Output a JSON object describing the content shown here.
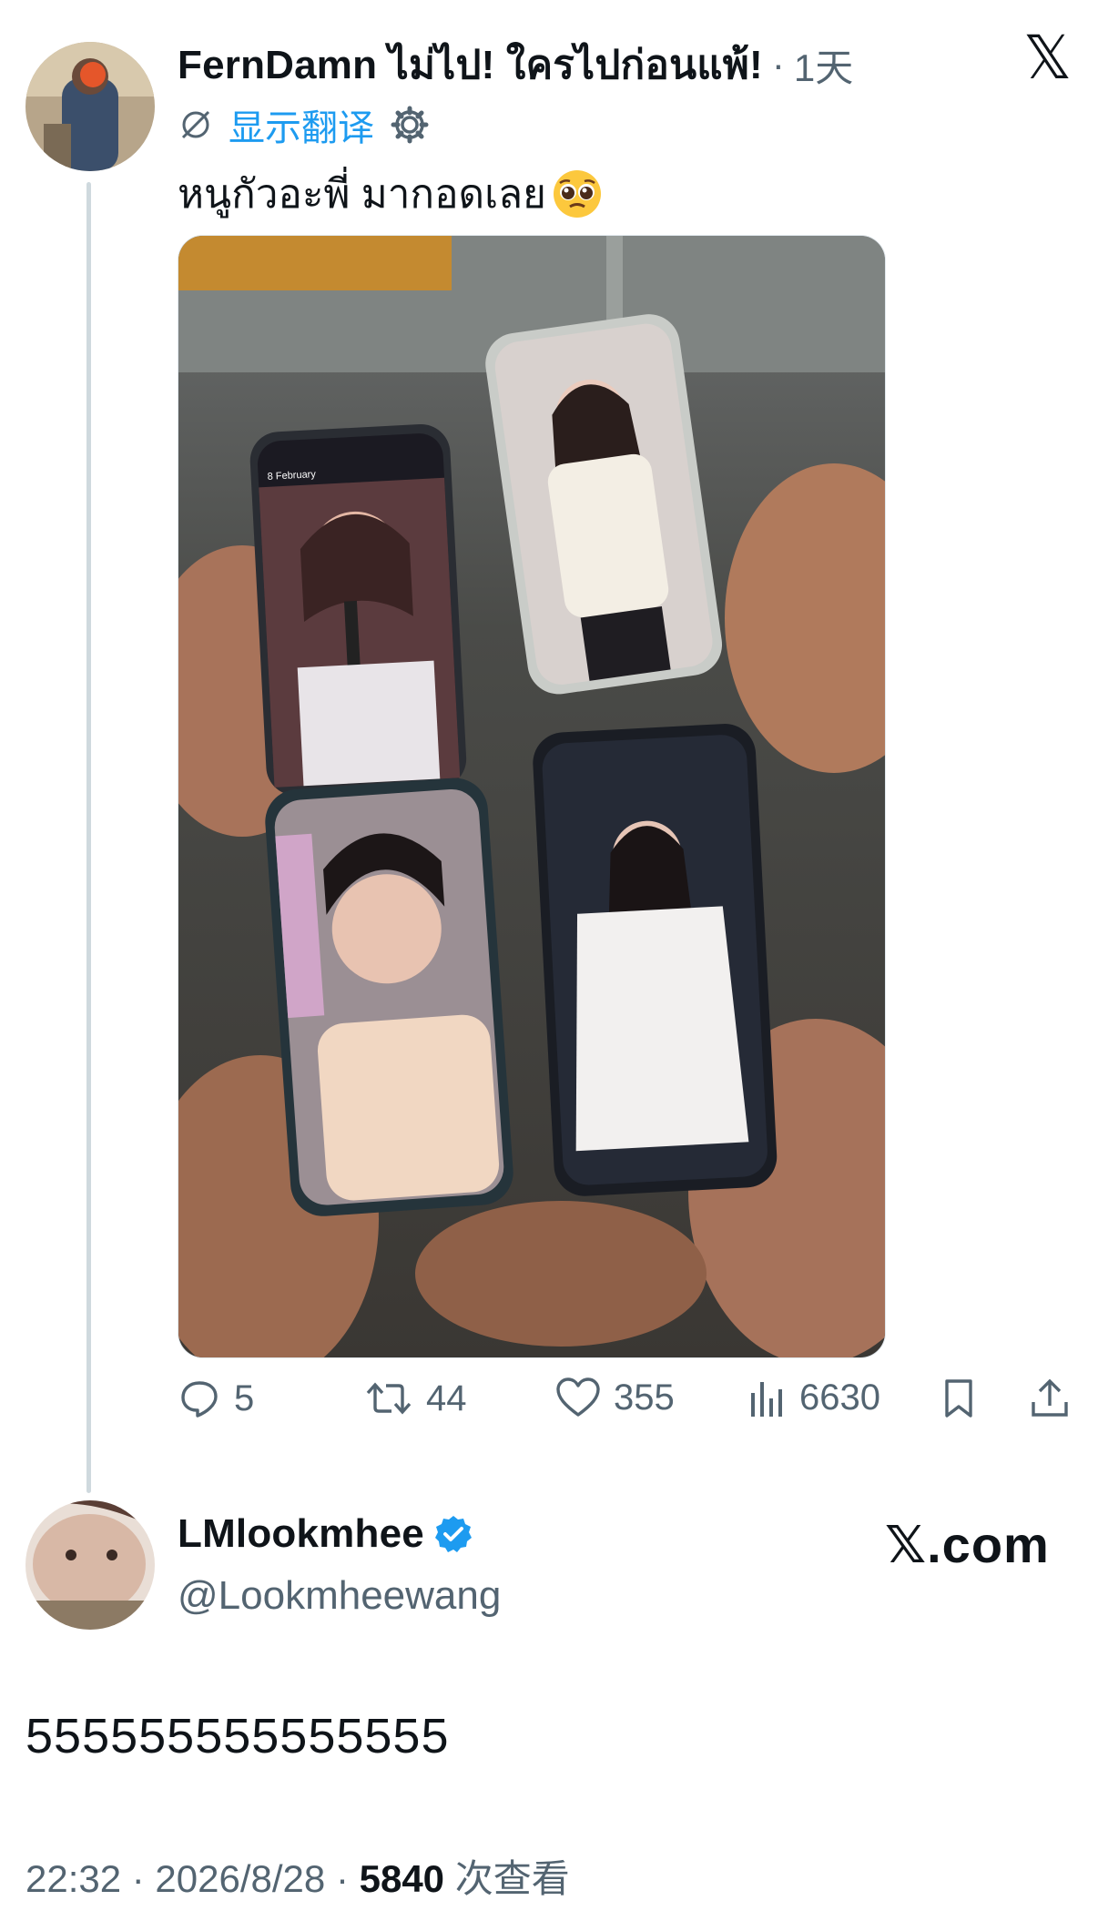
{
  "tweet": {
    "author": "FernDamn ไม่ไป! ใครไปก่อนแพ้!",
    "separator": "·",
    "time": "1天",
    "translate_label": "显示翻译",
    "text": "หนูกัวอะพี่ มากอดเลย",
    "emoji": "pleading-face",
    "media_screen_text": "8 February",
    "actions": {
      "replies": "5",
      "retweets": "44",
      "likes": "355",
      "views": "6630"
    }
  },
  "reply": {
    "author": "LMlookmhee",
    "verified": true,
    "handle": "@Lookmheewang",
    "brand": "𝕏.com",
    "text": "555555555555555",
    "footer_time": "22:32 · 2026/8/28 ·",
    "footer_views_count": "5840",
    "footer_views_label": "次查看"
  },
  "colors": {
    "accent": "#1d9bf0",
    "muted": "#536471",
    "thread_line": "#cfd9de",
    "text": "#0f1419"
  }
}
